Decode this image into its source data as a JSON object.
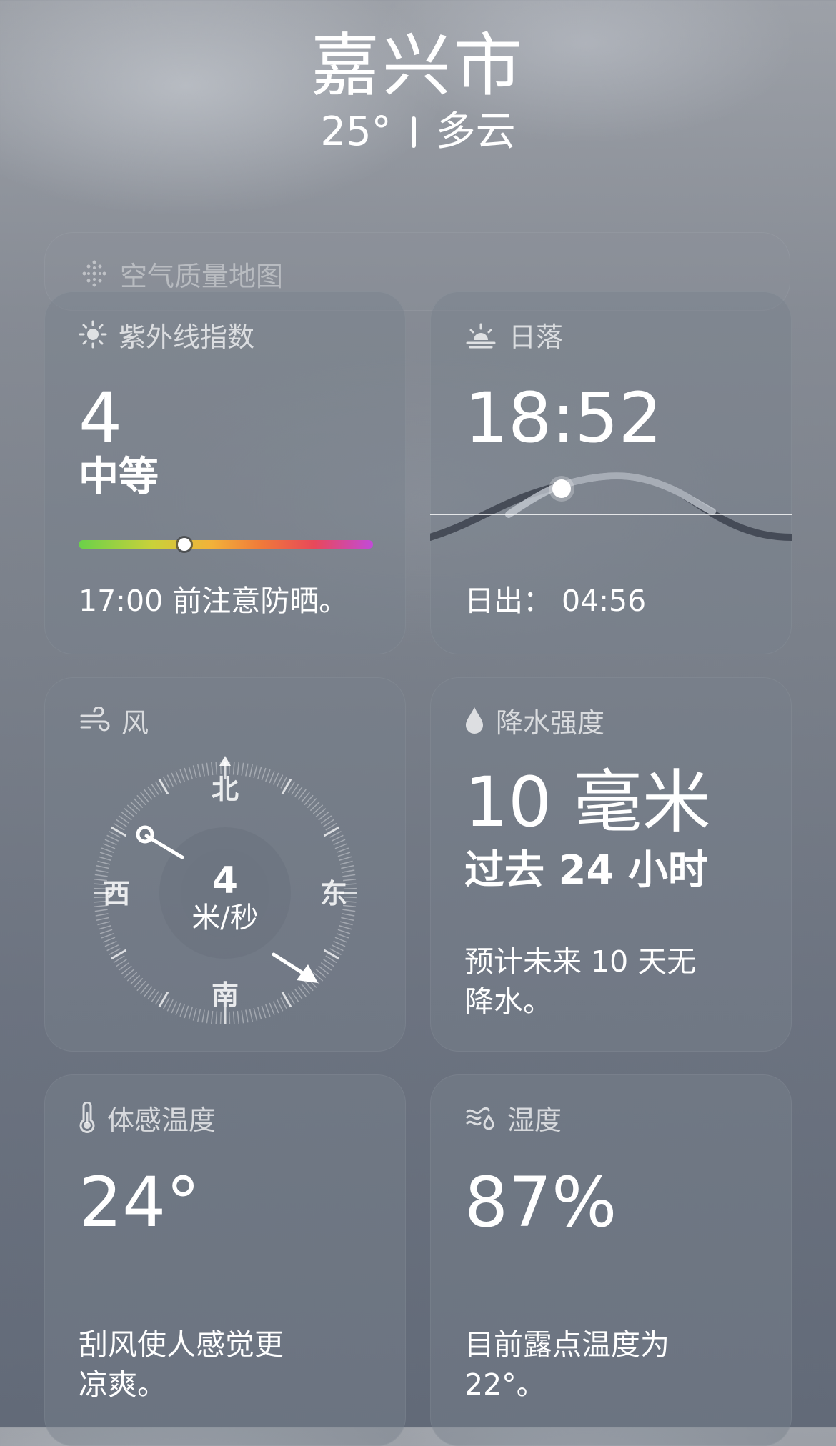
{
  "header": {
    "city": "嘉兴市",
    "temp": "25°",
    "condition": "多云"
  },
  "air_quality": {
    "title": "空气质量地图"
  },
  "uv": {
    "title": "紫外线指数",
    "value": "4",
    "level": "中等",
    "level_fraction": 0.36,
    "note": "17:00 前注意防晒。"
  },
  "sunset": {
    "title": "日落",
    "time": "18:52",
    "sunrise_label": "日出：",
    "sunrise_time": "04:56"
  },
  "wind": {
    "title": "风",
    "speed": "4",
    "unit": "米/秒",
    "north": "北",
    "south": "南",
    "east": "东",
    "west": "西"
  },
  "precip": {
    "title": "降水强度",
    "amount": "10 毫米",
    "period": "过去 24 小时",
    "note_line1": "预计未来 10 天无",
    "note_line2": "降水。"
  },
  "feels_like": {
    "title": "体感温度",
    "value": "24°",
    "note_line1": "刮风使人感觉更",
    "note_line2": "凉爽。"
  },
  "humidity": {
    "title": "湿度",
    "value": "87%",
    "note_line1": "目前露点温度为",
    "note_line2": "22°。"
  }
}
